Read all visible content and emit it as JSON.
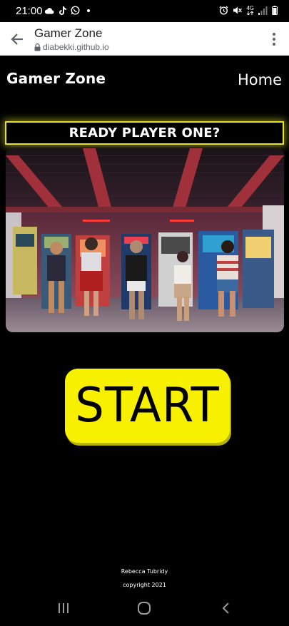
{
  "status_bar": {
    "time": "21:00",
    "left_icons": [
      "cloud-icon",
      "tiktok-icon",
      "whatsapp-icon",
      "notification-dot-icon"
    ],
    "right_icons": [
      "alarm-icon",
      "mute-icon",
      "4g-signal-icon",
      "battery-icon"
    ],
    "network_label": "4G"
  },
  "browser": {
    "title": "Gamer Zone",
    "url": "diabekki.github.io"
  },
  "header": {
    "logo": "Gamer Zone",
    "nav_home": "Home"
  },
  "banner": {
    "text": "READY PLAYER ONE?"
  },
  "hero": {
    "image_description_icon": "arcade-photo"
  },
  "start_button": {
    "label": "START"
  },
  "footer": {
    "author": "Rebecca Tubridy",
    "copyright": "copyright 2021"
  },
  "colors": {
    "accent_yellow": "#f7f100",
    "banner_border": "#e8e12a",
    "background": "#000000"
  }
}
